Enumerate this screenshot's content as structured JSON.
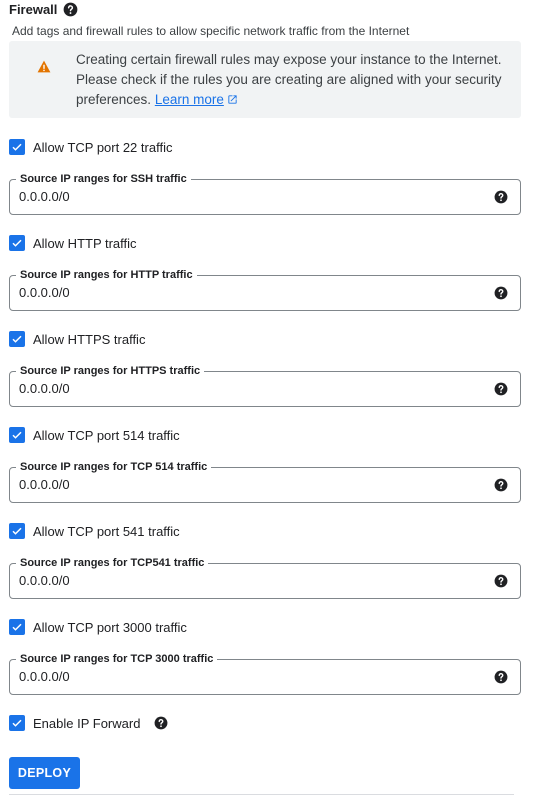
{
  "firewall": {
    "title": "Firewall",
    "description": "Add tags and firewall rules to allow specific network traffic from the Internet"
  },
  "warning": {
    "text": "Creating certain firewall rules may expose your instance to the Internet. Please check if the rules you are creating are aligned with your security preferences.",
    "link_label": "Learn more"
  },
  "rules": [
    {
      "checkbox_label": "Allow TCP port 22 traffic",
      "checked": true,
      "field_label": "Source IP ranges for SSH traffic",
      "value": "0.0.0.0/0"
    },
    {
      "checkbox_label": "Allow HTTP traffic",
      "checked": true,
      "field_label": "Source IP ranges for HTTP traffic",
      "value": "0.0.0.0/0"
    },
    {
      "checkbox_label": "Allow HTTPS traffic",
      "checked": true,
      "field_label": "Source IP ranges for HTTPS traffic",
      "value": "0.0.0.0/0"
    },
    {
      "checkbox_label": "Allow TCP port 514 traffic",
      "checked": true,
      "field_label": "Source IP ranges for TCP 514 traffic",
      "value": "0.0.0.0/0"
    },
    {
      "checkbox_label": "Allow TCP port 541 traffic",
      "checked": true,
      "field_label": "Source IP ranges for TCP541 traffic",
      "value": "0.0.0.0/0"
    },
    {
      "checkbox_label": "Allow TCP port 3000 traffic",
      "checked": true,
      "field_label": "Source IP ranges for TCP 3000 traffic",
      "value": "0.0.0.0/0"
    }
  ],
  "ip_forward": {
    "label": "Enable IP Forward",
    "checked": true
  },
  "deploy": {
    "label": "DEPLOY"
  },
  "colors": {
    "accent": "#1a73e8",
    "warning": "#e37400",
    "warning_bg": "#f1f3f4"
  },
  "icons": {
    "help": "help-circle-icon",
    "warning": "warning-triangle-icon",
    "external": "external-link-icon",
    "check": "check-icon"
  }
}
